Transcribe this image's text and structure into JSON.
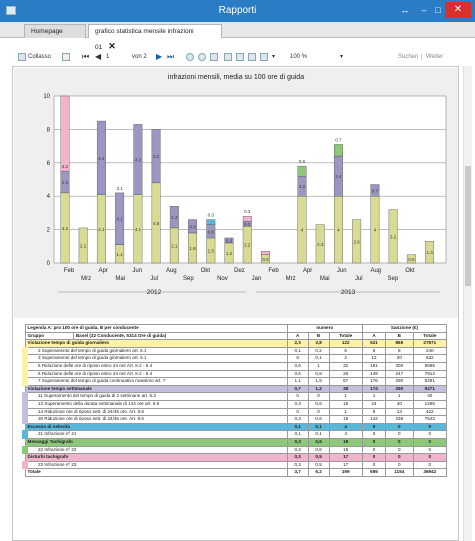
{
  "window": {
    "title": "Rapporti",
    "app_icon": "app-icon",
    "minimize": "–",
    "maximize": "□",
    "pin": "↔",
    "close": "✕"
  },
  "tabs": [
    {
      "label": "Homepage"
    },
    {
      "label": "grafico statistica mensile infrazioni 01",
      "close": "✕"
    }
  ],
  "toolbar": {
    "collapse": "Collasso",
    "page_current": "1",
    "page_of": "von 2",
    "zoom": "100 %",
    "search": "Suchen",
    "next": "Weiter"
  },
  "colors": {
    "titlebar": "#2a7cc4",
    "close": "#d9302c",
    "series_A": "#d8db94",
    "series_B": "#9a97c0",
    "highlight_yellow": "#fbf1a9",
    "highlight_cyan": "#5ab7d9",
    "highlight_green": "#8dc77a",
    "highlight_pink": "#f2b3cd"
  },
  "chart_data": {
    "type": "bar",
    "title": "infrazioni mensili, media su 100 ore di guida",
    "xlabels_top": [
      "Feb",
      "Apr",
      "Jun",
      "Aug",
      "Okt",
      "Dez",
      "Feb",
      "Apr",
      "Jun",
      "Aug",
      "Okt"
    ],
    "xlabels_bottom": [
      "Mrz",
      "Mai",
      "Jul",
      "Sep",
      "Nov",
      "Jan",
      "Mrz",
      "Mai",
      "Jul",
      "Sep"
    ],
    "year_labels": [
      "2012",
      "2013"
    ],
    "ylim": [
      0,
      10
    ],
    "yticks": [
      0,
      2,
      4,
      6,
      8,
      10
    ],
    "bars": [
      {
        "a": 4.2,
        "b": 1.3,
        "c": 0,
        "top": "pink"
      },
      {
        "a": 2.1,
        "b": 0,
        "c": 0,
        "top": ""
      },
      {
        "a": 4.1,
        "b": 4.4,
        "c": 0,
        "top": ""
      },
      {
        "a": 1.1,
        "b": 3.1,
        "c": 0,
        "top": ""
      },
      {
        "a": 4.1,
        "b": 4.2,
        "c": 0,
        "top": ""
      },
      {
        "a": 4.8,
        "b": 3.2,
        "c": 0,
        "top": ""
      },
      {
        "a": 2.1,
        "b": 1.3,
        "c": 0,
        "top": ""
      },
      {
        "a": 1.8,
        "b": 0.8,
        "c": 0,
        "top": ""
      },
      {
        "a": 1.5,
        "b": 0.8,
        "c": 0.3,
        "top": "cyan"
      },
      {
        "a": 1.2,
        "b": 0.3,
        "c": 0,
        "top": ""
      },
      {
        "a": 2.2,
        "b": 0.3,
        "c": 0.3,
        "top": "pink"
      },
      {
        "a": 0.5,
        "b": 0,
        "c": 0.2,
        "top": "pink"
      },
      {
        "a": 0,
        "b": 0,
        "c": 0,
        "top": ""
      },
      {
        "a": 4,
        "b": 1.2,
        "c": 0.6,
        "top": "green"
      },
      {
        "a": 2.3,
        "b": 0,
        "c": 0,
        "top": ""
      },
      {
        "a": 4,
        "b": 2.4,
        "c": 0.7,
        "top": "green"
      },
      {
        "a": 2.6,
        "b": 0,
        "c": 0,
        "top": ""
      },
      {
        "a": 4,
        "b": 0.7,
        "c": 0,
        "top": ""
      },
      {
        "a": 3.2,
        "b": 0,
        "c": 0,
        "top": ""
      },
      {
        "a": 0.5,
        "b": 0,
        "c": 0,
        "top": ""
      },
      {
        "a": 1.3,
        "b": 0,
        "c": 0,
        "top": ""
      }
    ],
    "value_labels": [
      {
        "bar": 0,
        "labels": [
          "4.2",
          "1.3",
          "4.2"
        ]
      },
      {
        "bar": 1,
        "labels": [
          "2.1"
        ]
      },
      {
        "bar": 2,
        "labels": [
          "4.1",
          "4.4"
        ]
      },
      {
        "bar": 3,
        "labels": [
          "1.1",
          "4.1",
          "3.1"
        ]
      },
      {
        "bar": 4,
        "labels": [
          "4.1",
          "4.2"
        ]
      },
      {
        "bar": 5,
        "labels": [
          "4.8",
          "3.2"
        ]
      },
      {
        "bar": 6,
        "labels": [
          "2.1",
          "1.3"
        ]
      },
      {
        "bar": 7,
        "labels": [
          "1.8",
          "0.8"
        ]
      },
      {
        "bar": 8,
        "labels": [
          "1.5",
          "0.8",
          "0.3"
        ]
      },
      {
        "bar": 9,
        "labels": [
          "1.2",
          "0.3"
        ]
      },
      {
        "bar": 10,
        "labels": [
          "2.2",
          "0.3",
          "0.3"
        ]
      },
      {
        "bar": 11,
        "labels": [
          "0.5"
        ]
      },
      {
        "bar": 13,
        "labels": [
          "4",
          "1.2",
          "0.6"
        ]
      },
      {
        "bar": 14,
        "labels": [
          "2.3"
        ]
      },
      {
        "bar": 15,
        "labels": [
          "4",
          "2.4",
          "0.7"
        ]
      },
      {
        "bar": 16,
        "labels": [
          "2.6"
        ]
      },
      {
        "bar": 17,
        "labels": [
          "4",
          "0.7"
        ]
      },
      {
        "bar": 18,
        "labels": [
          "3.2"
        ]
      },
      {
        "bar": 19,
        "labels": [
          "0.5"
        ]
      },
      {
        "bar": 20,
        "labels": [
          "1.3"
        ]
      }
    ]
  },
  "table": {
    "header1": [
      "Legenda A: pro 100 ore di guida, B per conducente",
      "",
      "numero",
      "",
      "",
      "Sanzione (€)",
      ""
    ],
    "header2": [
      "Gruppo",
      "Basel (32 Conducente, 5314 Ore di guida)",
      "A",
      "B",
      "Totale",
      "A",
      "B",
      "Totale"
    ],
    "rows": [
      {
        "t": "group",
        "c": "yellow",
        "cells": [
          "Violazione tempo di guida giornaliero",
          "2,3",
          "3,8",
          "122",
          "521",
          "865",
          "27671"
        ]
      },
      {
        "t": "sub",
        "c": "yellow",
        "cells": [
          "2 Superamento del tempo di guida giornaliero art. 6.1",
          "0,1",
          "0,2",
          "6",
          "5",
          "8",
          "240"
        ]
      },
      {
        "t": "sub",
        "c": "yellow",
        "cells": [
          "3 Superamento del tempo di guida giornaliero art. 6.1",
          "0",
          "0,1",
          "2",
          "12",
          "20",
          "632"
        ]
      },
      {
        "t": "sub",
        "c": "yellow",
        "cells": [
          "5 Riduzione delle ore di riposo entro 24 ore Art. 8.2 - 8.4",
          "0,6",
          "1",
          "32",
          "181",
          "300",
          "9596"
        ]
      },
      {
        "t": "sub",
        "c": "yellow",
        "cells": [
          "6 Riduzione delle ore di riposo entro 24 ore Art. 8.2 - 8.4",
          "0,5",
          "0,8",
          "26",
          "149",
          "247",
          "7912"
        ]
      },
      {
        "t": "sub",
        "c": "yellow",
        "cells": [
          "7 Superamento del tempo di guida continuativo massimo art. 7",
          "1,1",
          "1,8",
          "57",
          "176",
          "290",
          "9291"
        ]
      },
      {
        "t": "group",
        "c": "purple",
        "cells": [
          "Violazione tempo settimanale",
          "0,7",
          "1,2",
          "38",
          "174",
          "290",
          "9271"
        ]
      },
      {
        "t": "sub",
        "c": "purple",
        "cells": [
          "11 Superamento del tempo di guida di 2 settimane art. 6.3",
          "0",
          "0",
          "1",
          "1",
          "1",
          "40"
        ]
      },
      {
        "t": "sub",
        "c": "purple",
        "cells": [
          "13 Superamento della durata settimanale di 144 ore art. 8.6",
          "0,3",
          "0,6",
          "18",
          "24",
          "40",
          "1266"
        ]
      },
      {
        "t": "sub",
        "c": "purple",
        "cells": [
          "14 Riduzione ore di riposo sett. di 24/45 ore. Art. 8.6",
          "0",
          "0",
          "1",
          "8",
          "13",
          "422"
        ]
      },
      {
        "t": "sub",
        "c": "purple",
        "cells": [
          "30 Riduzione ore di riposo sett. di 24/45 ore. Art. 8.6",
          "0,3",
          "0,6",
          "18",
          "142",
          "236",
          "7543"
        ]
      },
      {
        "t": "group",
        "c": "cyan",
        "cells": [
          "Eccesso di velocità",
          "0,1",
          "0,1",
          "4",
          "0",
          "0",
          "0"
        ]
      },
      {
        "t": "sub",
        "c": "cyan",
        "cells": [
          "21 Infrazione nº 21",
          "0,1",
          "0,1",
          "4",
          "0",
          "0",
          "0"
        ]
      },
      {
        "t": "group",
        "c": "green",
        "cells": [
          "Messaggi Tachigrafo",
          "0,3",
          "0,6",
          "18",
          "0",
          "0",
          "0"
        ]
      },
      {
        "t": "sub",
        "c": "green",
        "cells": [
          "22 Infrazione nº 22",
          "0,3",
          "0,6",
          "18",
          "0",
          "0",
          "0"
        ]
      },
      {
        "t": "group",
        "c": "pink",
        "cells": [
          "Disturbi tachigrafo",
          "0,3",
          "0,5",
          "17",
          "0",
          "0",
          "0"
        ]
      },
      {
        "t": "sub",
        "c": "pink",
        "cells": [
          "23 Infrazione nº 23",
          "0,3",
          "0,5",
          "17",
          "0",
          "0",
          "0"
        ]
      },
      {
        "t": "total",
        "c": "white",
        "cells": [
          "Totale",
          "3,7",
          "6,2",
          "199",
          "695",
          "1154",
          "36942"
        ]
      }
    ]
  }
}
